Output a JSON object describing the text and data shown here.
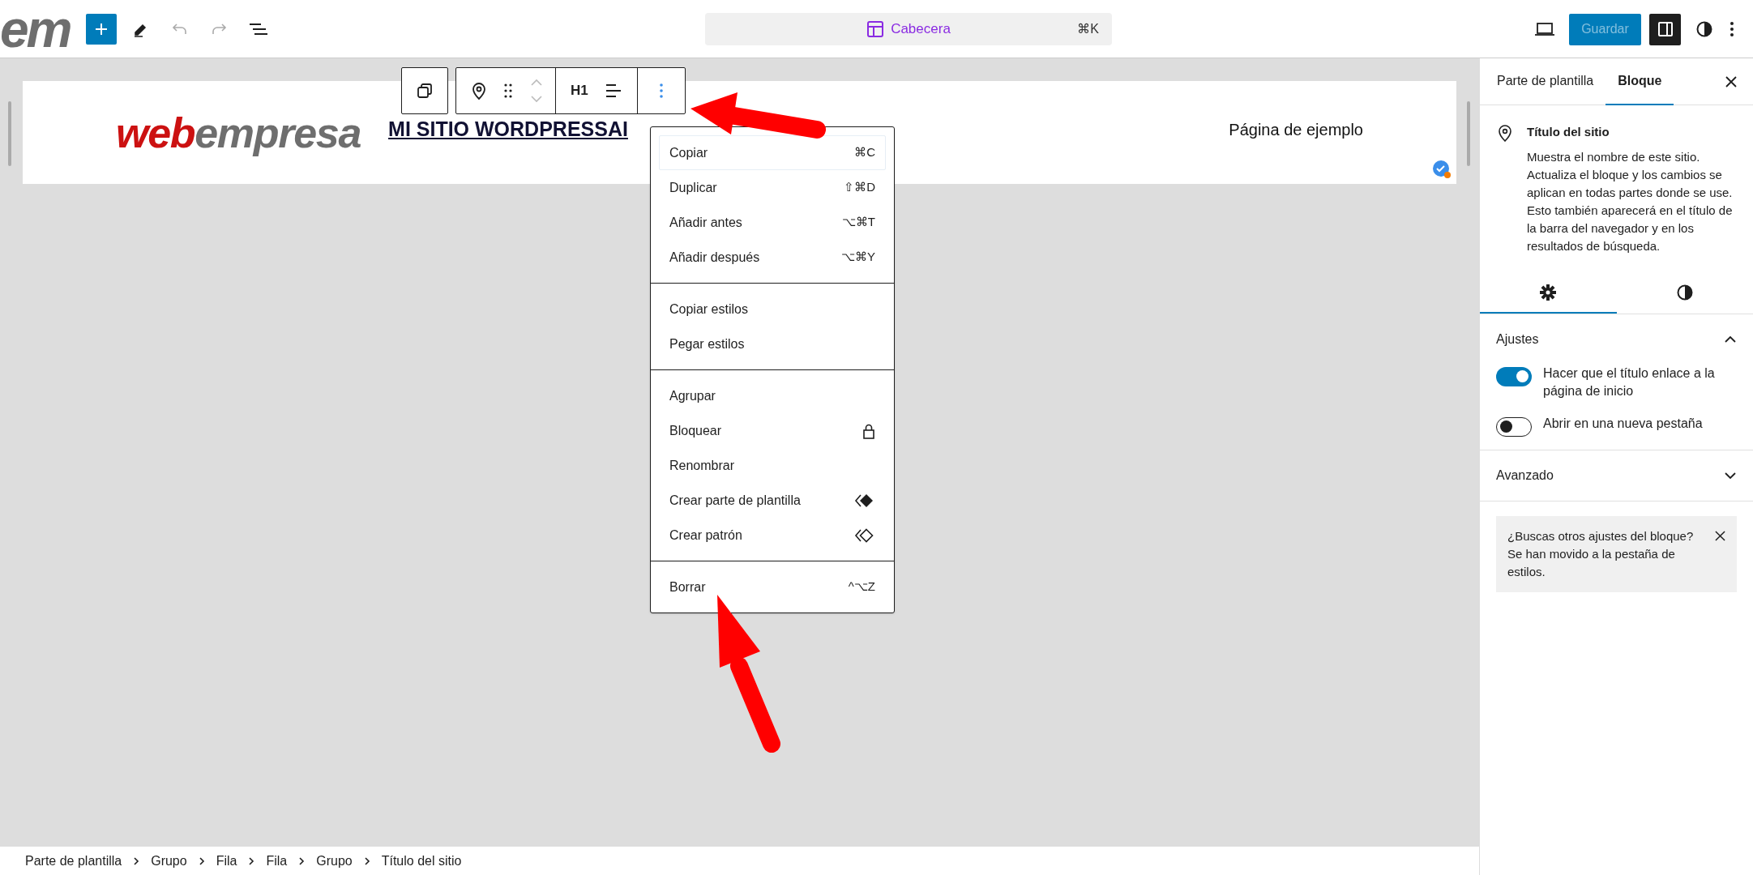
{
  "top_bar": {
    "logo_fragment": "em",
    "command_bar": {
      "label": "Cabecera",
      "shortcut": "⌘K"
    },
    "save_button": {
      "label": "Guardar",
      "disabled": true
    },
    "sidebar_toggle": {
      "on": true
    }
  },
  "header_block": {
    "logo": [
      {
        "text": "web",
        "color": "#cc1111"
      },
      {
        "text": "empresa",
        "color": "#6e6e6e"
      }
    ],
    "site_title": "MI SITIO WORDPRESSAI",
    "nav_link": "Página de ejemplo"
  },
  "block_toolbar": {
    "heading_level": "H1"
  },
  "options_menu": {
    "groups": [
      [
        {
          "label": "Copiar",
          "kind": "shortcut",
          "shortcut": "⌘C",
          "focused": true
        },
        {
          "label": "Duplicar",
          "kind": "shortcut",
          "shortcut": "⇧⌘D",
          "focused": false
        },
        {
          "label": "Añadir antes",
          "kind": "shortcut",
          "shortcut": "⌥⌘T",
          "focused": false
        },
        {
          "label": "Añadir después",
          "kind": "shortcut",
          "shortcut": "⌥⌘Y",
          "focused": false
        }
      ],
      [
        {
          "label": "Copiar estilos",
          "kind": "plain",
          "focused": false
        },
        {
          "label": "Pegar estilos",
          "kind": "plain",
          "focused": false
        }
      ],
      [
        {
          "label": "Agrupar",
          "kind": "plain",
          "focused": false
        },
        {
          "label": "Bloquear",
          "kind": "lock",
          "focused": false
        },
        {
          "label": "Renombrar",
          "kind": "plain",
          "focused": false
        },
        {
          "label": "Crear parte de plantilla",
          "kind": "templatepart",
          "focused": false
        },
        {
          "label": "Crear patrón",
          "kind": "pattern",
          "focused": false
        }
      ],
      [
        {
          "label": "Borrar",
          "kind": "shortcut",
          "shortcut": "^⌥Z",
          "focused": false
        }
      ]
    ]
  },
  "sidebar": {
    "tabs": [
      {
        "label": "Parte de plantilla",
        "selected": false
      },
      {
        "label": "Bloque",
        "selected": true
      }
    ],
    "block_card": {
      "title": "Título del sitio",
      "description": "Muestra el nombre de este sitio. Actualiza el bloque y los cambios se aplican en todas partes donde se use. Esto también aparecerá en el título de la barra del navegador y en los resultados de búsqueda."
    },
    "inspector_tabs": [
      {
        "kind": "settings",
        "selected": true
      },
      {
        "kind": "styles",
        "selected": false
      }
    ],
    "panels": [
      {
        "title": "Ajustes",
        "expanded": true,
        "toggles": [
          {
            "label": "Hacer que el título enlace a la página de inicio",
            "on": true
          },
          {
            "label": "Abrir en una nueva pestaña",
            "on": false
          }
        ]
      },
      {
        "title": "Avanzado",
        "expanded": false
      }
    ],
    "notice": "¿Buscas otros ajustes del bloque? Se han movido a la pestaña de estilos."
  },
  "breadcrumb": [
    "Parte de plantilla",
    "Grupo",
    "Fila",
    "Fila",
    "Grupo",
    "Título del sitio"
  ]
}
